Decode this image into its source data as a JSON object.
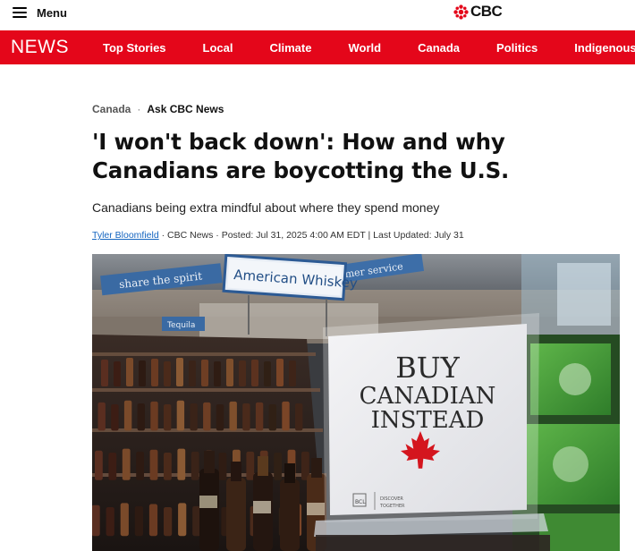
{
  "header": {
    "menu_label": "Menu",
    "logo_text": "CBC"
  },
  "nav": {
    "section_word": "NEWS",
    "items": [
      "Top Stories",
      "Local",
      "Climate",
      "World",
      "Canada",
      "Politics",
      "Indigenous"
    ]
  },
  "article": {
    "breadcrumb": [
      "Canada",
      "Ask CBC News"
    ],
    "headline": "'I won't back down': How and why Canadians are boycotting the U.S.",
    "deck": "Canadians being extra mindful about where they spend money",
    "byline": {
      "author": "Tyler Bloomfield",
      "rest": " · CBC News · Posted: Jul 31, 2025 4:00 AM EDT | Last Updated: July 31"
    },
    "photo": {
      "aisle_sign": "American Whiskey",
      "banner_1": "share the spirit",
      "banner_2": "mer service",
      "small_sign": "Tequila",
      "placard_lines": [
        "BUY",
        "CANADIAN",
        "INSTEAD"
      ],
      "placard_footer_1": "DISCOVER",
      "placard_footer_2": "TOGETHER",
      "placard_logo": "BCL"
    }
  },
  "colors": {
    "brand_red": "#e4061a",
    "link_blue": "#1565c0"
  }
}
